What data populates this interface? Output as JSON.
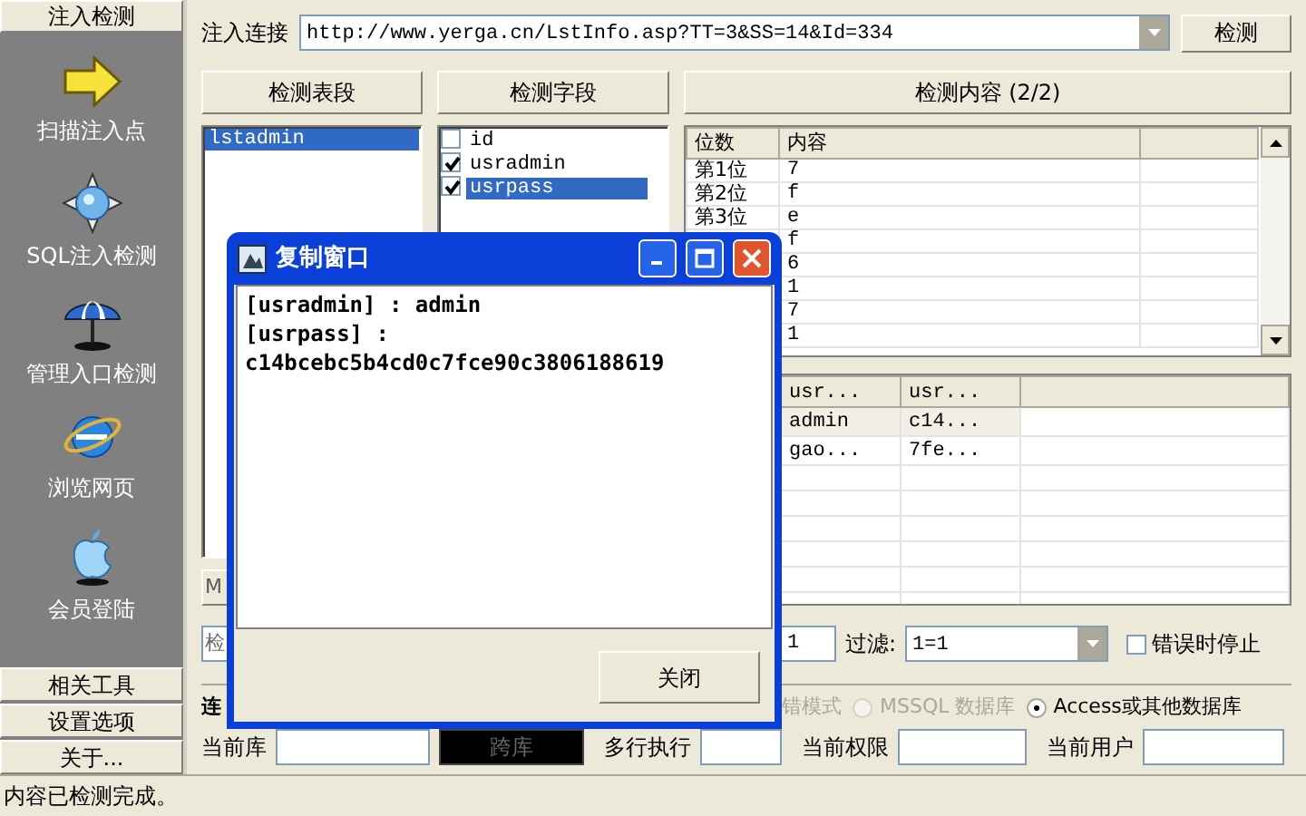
{
  "sidebar": {
    "header": "注入检测",
    "items": [
      {
        "label": "扫描注入点",
        "kind": "arrow"
      },
      {
        "label": "SQL注入检测",
        "kind": "compass"
      },
      {
        "label": "管理入口检测",
        "kind": "umbrella"
      },
      {
        "label": "浏览网页",
        "kind": "globe"
      },
      {
        "label": "会员登陆",
        "kind": "apple"
      }
    ],
    "buttons": [
      "相关工具",
      "设置选项",
      "关于..."
    ]
  },
  "url_bar": {
    "label": "注入连接",
    "value": "http://www.yerga.cn/LstInfo.asp?TT=3&SS=14&Id=334",
    "button": "检测"
  },
  "tables_panel": {
    "header": "检测表段",
    "items": [
      {
        "label": "lstadmin",
        "selected": true
      }
    ],
    "button": "M"
  },
  "fields_panel": {
    "header": "检测字段",
    "items": [
      {
        "label": "id",
        "checked": false,
        "selected": false
      },
      {
        "label": "usradmin",
        "checked": true,
        "selected": false
      },
      {
        "label": "usrpass",
        "checked": true,
        "selected": true
      }
    ]
  },
  "content_panel": {
    "header": "检测内容 (2/2)",
    "columns": [
      "位数",
      "内容"
    ],
    "rows": [
      {
        "position": "第1位",
        "value": "7"
      },
      {
        "position": "第2位",
        "value": "f"
      },
      {
        "position": "第3位",
        "value": "e"
      },
      {
        "value": "f"
      },
      {
        "value": "6"
      },
      {
        "value": "1"
      },
      {
        "value": "7"
      },
      {
        "value": "1"
      }
    ]
  },
  "results_table": {
    "columns": [
      "usr...",
      "usr..."
    ],
    "rows": [
      {
        "cells": [
          "admin",
          "c14..."
        ],
        "selected": true
      },
      {
        "cells": [
          "gao...",
          "7fe..."
        ],
        "selected": false
      }
    ]
  },
  "options": {
    "field_text": "检",
    "count": "1",
    "filter_label": "过滤:",
    "filter_value": "1=1",
    "stop_on_error": {
      "label": "错误时停止",
      "checked": false
    }
  },
  "connection": {
    "label": "连",
    "partial_text": "错模式",
    "modes": [
      {
        "label": "MSSQL 数据库",
        "selected": false,
        "disabled": true
      },
      {
        "label": "Access或其他数据库",
        "selected": true,
        "disabled": false
      }
    ]
  },
  "info_row": [
    {
      "kind": "field",
      "label": "当前库"
    },
    {
      "kind": "button",
      "label": "跨库"
    },
    {
      "kind": "field",
      "label": "多行执行"
    },
    {
      "kind": "field",
      "label": "当前权限"
    },
    {
      "kind": "field",
      "label": "当前用户"
    }
  ],
  "dialog": {
    "title": "复制窗口",
    "lines": [
      "[usradmin] : admin",
      "[usrpass] :",
      "c14bcebc5b4cd0c7fce90c3806188619"
    ],
    "button": "关闭"
  },
  "status_bar": "内容已检测完成。"
}
